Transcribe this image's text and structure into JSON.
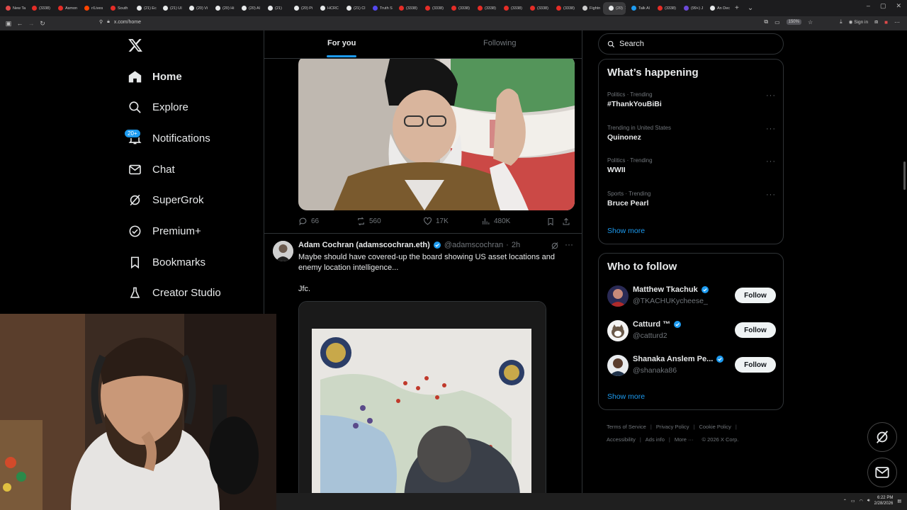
{
  "browser": {
    "tabs": [
      {
        "title": "New Ta",
        "color": "#e04a4a"
      },
      {
        "title": "(3338)",
        "color": "#e52d27"
      },
      {
        "title": "Asmon",
        "color": "#e52d27"
      },
      {
        "title": "r/Lives",
        "color": "#ff4500"
      },
      {
        "title": "South",
        "color": "#e52d27"
      },
      {
        "title": "(21) Ec",
        "color": "#e7e9ea"
      },
      {
        "title": "(21) UI",
        "color": "#e7e9ea"
      },
      {
        "title": "(20) Vi",
        "color": "#e7e9ea"
      },
      {
        "title": "(20) Hi",
        "color": "#e7e9ea"
      },
      {
        "title": "(20) Al",
        "color": "#e7e9ea"
      },
      {
        "title": "(21)",
        "color": "#e7e9ea"
      },
      {
        "title": "(20) Pi",
        "color": "#e7e9ea"
      },
      {
        "title": "HCRC",
        "color": "#e7e9ea"
      },
      {
        "title": "(21) Cl",
        "color": "#e7e9ea"
      },
      {
        "title": "Truth S",
        "color": "#5448ee"
      },
      {
        "title": "(3338)",
        "color": "#e52d27"
      },
      {
        "title": "(3338)",
        "color": "#e52d27"
      },
      {
        "title": "(3338)",
        "color": "#e52d27"
      },
      {
        "title": "(3338)",
        "color": "#e52d27"
      },
      {
        "title": "(3338)",
        "color": "#e52d27"
      },
      {
        "title": "(3338)",
        "color": "#e52d27"
      },
      {
        "title": "(3338)",
        "color": "#e52d27"
      },
      {
        "title": "Fightn",
        "color": "#cccccc"
      },
      {
        "title": "(20)",
        "color": "#e7e9ea",
        "active": true
      },
      {
        "title": "Talk Al",
        "color": "#1d9bf0"
      },
      {
        "title": "(3338)",
        "color": "#e52d27"
      },
      {
        "title": "(99+) J",
        "color": "#6c4ad9"
      },
      {
        "title": "An Dec",
        "color": "#e7e9ea"
      }
    ],
    "url": "x.com/home",
    "zoom": "150%",
    "sign_in": "Sign in"
  },
  "nav": {
    "items": [
      {
        "label": "Home",
        "icon": "home-icon"
      },
      {
        "label": "Explore",
        "icon": "search-icon"
      },
      {
        "label": "Notifications",
        "icon": "bell-icon",
        "badge": "20+"
      },
      {
        "label": "Chat",
        "icon": "mail-icon"
      },
      {
        "label": "SuperGrok",
        "icon": "grok-icon"
      },
      {
        "label": "Premium+",
        "icon": "verified-icon"
      },
      {
        "label": "Bookmarks",
        "icon": "bookmark-icon"
      },
      {
        "label": "Creator Studio",
        "icon": "flask-icon"
      }
    ]
  },
  "feed": {
    "tabs": {
      "for_you": "For you",
      "following": "Following"
    },
    "post1": {
      "replies": "66",
      "reposts": "560",
      "likes": "17K",
      "views": "480K"
    },
    "post2": {
      "name": "Adam Cochran (adamscochran.eth)",
      "handle": "@adamscochran",
      "time": "2h",
      "text": "Maybe should have covered-up the board showing US asset locations and enemy location intelligence...",
      "text2": "Jfc."
    }
  },
  "sidebar": {
    "search_placeholder": "Search",
    "happening": {
      "title": "What’s happening",
      "trends": [
        {
          "meta": "Politics · Trending",
          "name": "#ThankYouBiBi"
        },
        {
          "meta": "Trending in United States",
          "name": "Quinonez"
        },
        {
          "meta": "Politics · Trending",
          "name": "WWII"
        },
        {
          "meta": "Sports · Trending",
          "name": "Bruce Pearl"
        }
      ],
      "show_more": "Show more"
    },
    "who_to_follow": {
      "title": "Who to follow",
      "accounts": [
        {
          "name": "Matthew Tkachuk",
          "handle": "@TKACHUKycheese_",
          "button": "Follow"
        },
        {
          "name": "Catturd ™",
          "handle": "@catturd2",
          "button": "Follow"
        },
        {
          "name": "Shanaka Anslem Pe...",
          "handle": "@shanaka86",
          "button": "Follow"
        }
      ],
      "show_more": "Show more"
    },
    "footer": {
      "terms": "Terms of Service",
      "privacy": "Privacy Policy",
      "cookie": "Cookie Policy",
      "accessibility": "Accessibility",
      "ads": "Ads info",
      "more": "More ···",
      "copyright": "© 2026 X Corp."
    }
  },
  "taskbar": {
    "time": "6:22 PM",
    "date": "2/28/2026"
  },
  "colors": {
    "accent": "#1d9bf0",
    "bg": "#000000",
    "border": "#2f3336",
    "muted": "#71767b"
  }
}
